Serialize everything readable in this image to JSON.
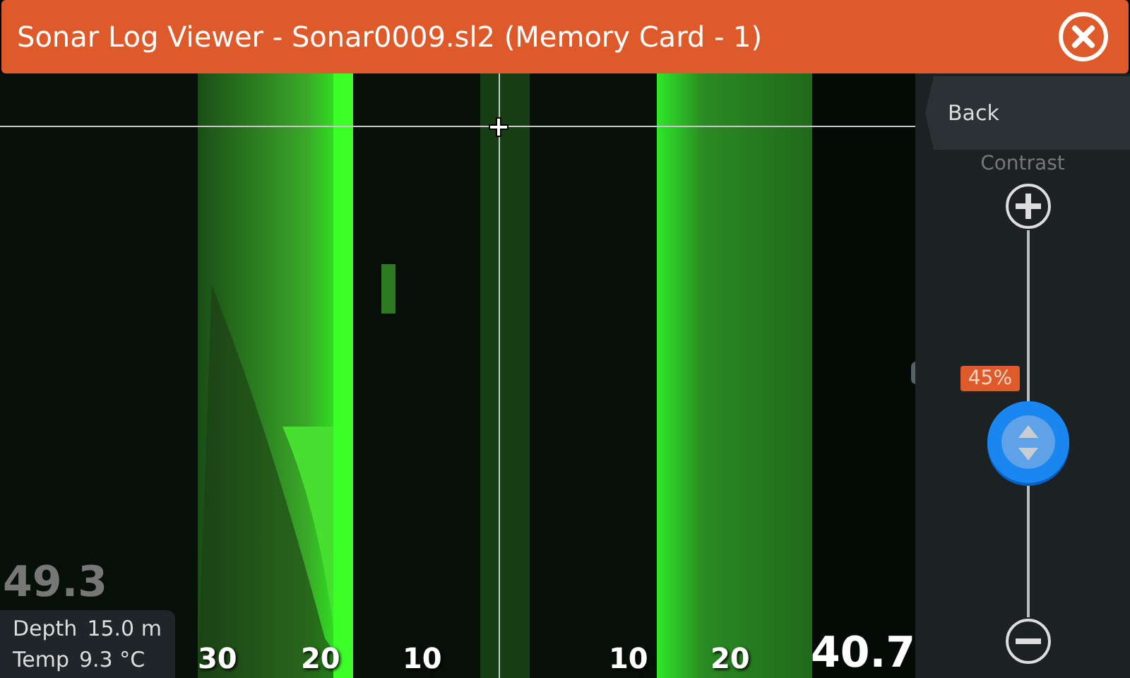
{
  "window": {
    "title": "Sonar Log Viewer - Sonar0009.sl2 (Memory Card - 1)"
  },
  "sonar": {
    "kind": "picture",
    "range_labels": [
      "30",
      "20",
      "10",
      "10",
      "20"
    ],
    "left_reading": "49.3",
    "right_reading": "40.7",
    "info": [
      {
        "label": "Depth",
        "value": "15.0  m"
      },
      {
        "label": "Temp",
        "value": "9.3 °C"
      }
    ]
  },
  "panel": {
    "back": "Back",
    "contrast": {
      "label": "Contrast",
      "level": 0.45,
      "reading": "45%"
    }
  }
}
